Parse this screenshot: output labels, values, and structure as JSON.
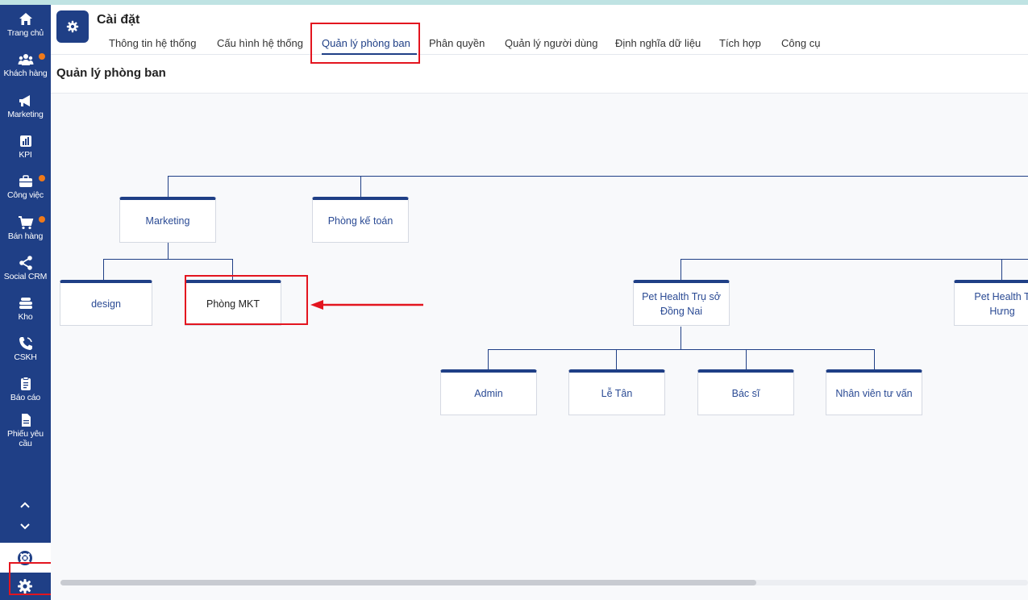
{
  "colors": {
    "sidebar": "#1f3f86",
    "accent": "#1f3f86",
    "badge": "#f07a1a",
    "highlight": "#e3151f"
  },
  "sidebar": {
    "items": [
      {
        "label": "Trang chủ",
        "icon": "home-icon",
        "badge": false
      },
      {
        "label": "Khách hàng",
        "icon": "customers-icon",
        "badge": true
      },
      {
        "label": "Marketing",
        "icon": "megaphone-icon",
        "badge": false
      },
      {
        "label": "KPI",
        "icon": "chart-icon",
        "badge": false
      },
      {
        "label": "Công việc",
        "icon": "briefcase-icon",
        "badge": true
      },
      {
        "label": "Bán hàng",
        "icon": "cart-icon",
        "badge": true
      },
      {
        "label": "Social CRM",
        "icon": "share-icon",
        "badge": false
      },
      {
        "label": "Kho",
        "icon": "warehouse-icon",
        "badge": false
      },
      {
        "label": "CSKH",
        "icon": "phone-icon",
        "badge": false
      },
      {
        "label": "Báo cáo",
        "icon": "clipboard-icon",
        "badge": false
      },
      {
        "label": "Phiếu yêu cầu",
        "icon": "document-icon",
        "badge": false
      }
    ],
    "scroll_up": "chevron-up-icon",
    "scroll_down": "chevron-down-icon",
    "support": "lifebuoy-icon",
    "settings": "gear-icon"
  },
  "header": {
    "title": "Cài đặt",
    "tabs": [
      {
        "label": "Thông tin hệ thống",
        "active": false
      },
      {
        "label": "Cấu hình hệ thống",
        "active": false
      },
      {
        "label": "Quản lý phòng ban",
        "active": true
      },
      {
        "label": "Phân quyền",
        "active": false
      },
      {
        "label": "Quản lý người dùng",
        "active": false
      },
      {
        "label": "Định nghĩa dữ liệu",
        "active": false
      },
      {
        "label": "Tích hợp",
        "active": false
      },
      {
        "label": "Công cụ",
        "active": false
      }
    ]
  },
  "main": {
    "section_title": "Quản lý phòng ban",
    "org_chart": {
      "marketing": "Marketing",
      "accounting": "Phòng kế toán",
      "design": "design",
      "mkt": "Phòng MKT",
      "hq": "Pet Health Trụ sở Đồng Nai",
      "branch": "Pet Health T Hưng",
      "admin": "Admin",
      "reception": "Lễ Tân",
      "doctor": "Bác sĩ",
      "consultant": "Nhân viên tư vấn"
    }
  }
}
